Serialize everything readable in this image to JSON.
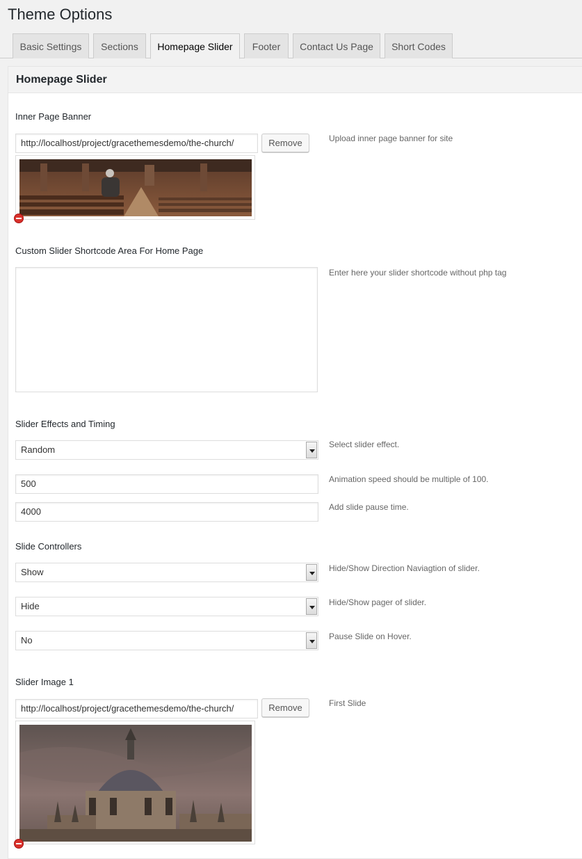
{
  "page": {
    "title": "Theme Options"
  },
  "tabs": [
    {
      "label": "Basic Settings"
    },
    {
      "label": "Sections"
    },
    {
      "label": "Homepage Slider"
    },
    {
      "label": "Footer"
    },
    {
      "label": "Contact Us Page"
    },
    {
      "label": "Short Codes"
    }
  ],
  "panel": {
    "title": "Homepage Slider"
  },
  "banner": {
    "title": "Inner Page Banner",
    "url": "http://localhost/project/gracethemesdemo/the-church/",
    "remove_label": "Remove",
    "desc": "Upload inner page banner for site"
  },
  "shortcode": {
    "title": "Custom Slider Shortcode Area For Home Page",
    "value": "",
    "desc": "Enter here your slider shortcode without php tag"
  },
  "effects": {
    "title": "Slider Effects and Timing",
    "effect_value": "Random",
    "effect_desc": "Select slider effect.",
    "speed_value": "500",
    "speed_desc": "Animation speed should be multiple of 100.",
    "pause_value": "4000",
    "pause_desc": "Add slide pause time."
  },
  "controllers": {
    "title": "Slide Controllers",
    "direction_value": "Show",
    "direction_desc": "Hide/Show Direction Naviagtion of slider.",
    "pager_value": "Hide",
    "pager_desc": "Hide/Show pager of slider.",
    "hover_value": "No",
    "hover_desc": "Pause Slide on Hover."
  },
  "slide1": {
    "title": "Slider Image 1",
    "url": "http://localhost/project/gracethemesdemo/the-church/",
    "remove_label": "Remove",
    "desc": "First Slide"
  },
  "colors": {
    "accent": "#23282d",
    "tab_bg": "#e4e4e4",
    "remove_red": "#d9322c"
  }
}
